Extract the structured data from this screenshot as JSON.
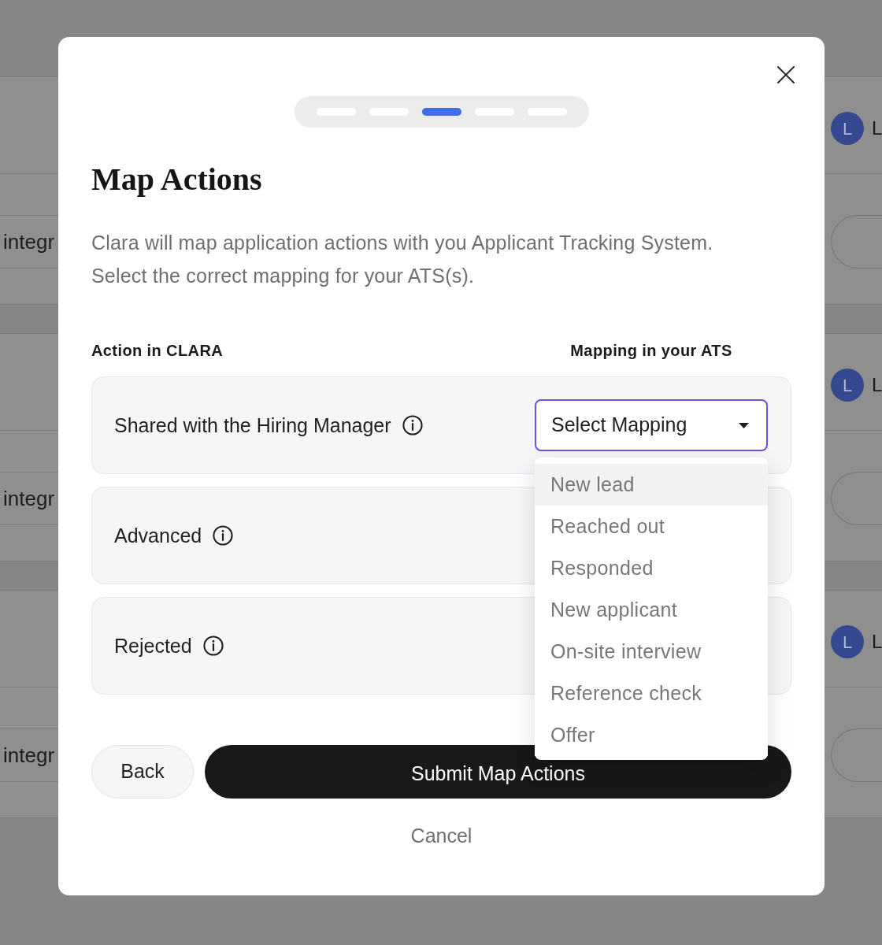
{
  "background": {
    "cards": [
      {
        "avatar": "L",
        "name": "L",
        "row_text": "integr"
      },
      {
        "avatar": "L",
        "name": "L",
        "row_text": "integr"
      },
      {
        "avatar": "L",
        "name": "L",
        "row_text": "integr"
      }
    ]
  },
  "modal": {
    "steps": [
      {
        "current": false
      },
      {
        "current": false
      },
      {
        "current": true
      },
      {
        "current": false
      },
      {
        "current": false
      }
    ],
    "title": "Map Actions",
    "description": [
      "Clara will map application actions with you Applicant Tracking System.",
      "Select the correct mapping for your ATS(s)."
    ],
    "columns": [
      "Action in CLARA",
      "Mapping in your ATS"
    ],
    "rows": [
      {
        "label": "Shared with the Hiring Manager",
        "mapping": {
          "value": "Select Mapping",
          "focused": true,
          "open": true,
          "options": [
            {
              "label": "New lead",
              "highlighted": true
            },
            {
              "label": "Reached out",
              "highlighted": false
            },
            {
              "label": "Responded",
              "highlighted": false
            },
            {
              "label": "New applicant",
              "highlighted": false
            },
            {
              "label": "On-site interview",
              "highlighted": false
            },
            {
              "label": "Reference check",
              "highlighted": false
            },
            {
              "label": "Offer",
              "highlighted": false
            }
          ]
        }
      },
      {
        "label": "Advanced"
      },
      {
        "label": "Rejected"
      }
    ],
    "buttons": {
      "back": "Back",
      "submit": "Submit Map Actions",
      "cancel": "Cancel"
    }
  }
}
